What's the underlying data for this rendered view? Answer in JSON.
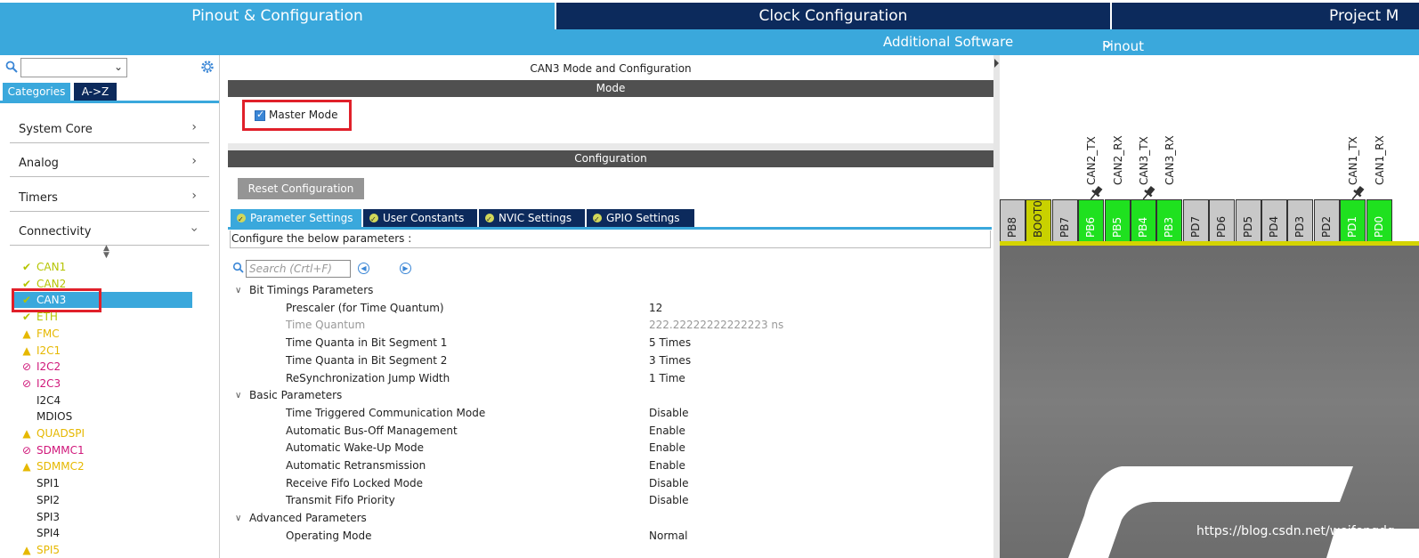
{
  "top_tabs": [
    {
      "label": "Pinout & Configuration"
    },
    {
      "label": "Clock Configuration"
    },
    {
      "label": "Project M"
    }
  ],
  "subbar": {
    "additional_software": "Additional Software",
    "pinout": "Pinout"
  },
  "left": {
    "tabs": [
      "Categories",
      "A->Z"
    ],
    "categories": [
      "System Core",
      "Analog",
      "Timers",
      "Connectivity"
    ],
    "items": [
      {
        "label": "CAN1",
        "status": "ok"
      },
      {
        "label": "CAN2",
        "status": "ok"
      },
      {
        "label": "CAN3",
        "status": "ok"
      },
      {
        "label": "ETH",
        "status": "ok"
      },
      {
        "label": "FMC",
        "status": "warning"
      },
      {
        "label": "I2C1",
        "status": "warning"
      },
      {
        "label": "I2C2",
        "status": "disabled"
      },
      {
        "label": "I2C3",
        "status": "disabled"
      },
      {
        "label": "I2C4",
        "status": "none"
      },
      {
        "label": "MDIOS",
        "status": "none"
      },
      {
        "label": "QUADSPI",
        "status": "warning"
      },
      {
        "label": "SDMMC1",
        "status": "disabled"
      },
      {
        "label": "SDMMC2",
        "status": "warning"
      },
      {
        "label": "SPI1",
        "status": "none"
      },
      {
        "label": "SPI2",
        "status": "none"
      },
      {
        "label": "SPI3",
        "status": "none"
      },
      {
        "label": "SPI4",
        "status": "none"
      },
      {
        "label": "SPI5",
        "status": "warning"
      }
    ],
    "selected_item": "CAN3"
  },
  "middle": {
    "title": "CAN3 Mode and Configuration",
    "mode_header": "Mode",
    "master_mode_label": "Master Mode",
    "master_mode_checked": true,
    "config_header": "Configuration",
    "reset_button": "Reset Configuration",
    "param_tabs": [
      "Parameter Settings",
      "User Constants",
      "NVIC Settings",
      "GPIO Settings"
    ],
    "configure_text": "Configure the below parameters :",
    "search_placeholder": "Search (Crtl+F)",
    "groups": [
      {
        "name": "Bit Timings Parameters",
        "params": [
          {
            "name": "Prescaler (for Time Quantum)",
            "value": "12",
            "muted": false
          },
          {
            "name": "Time Quantum",
            "value": "222.22222222222223 ns",
            "muted": true
          },
          {
            "name": "Time Quanta in Bit Segment 1",
            "value": "5 Times",
            "muted": false
          },
          {
            "name": "Time Quanta in Bit Segment 2",
            "value": "3 Times",
            "muted": false
          },
          {
            "name": "ReSynchronization Jump Width",
            "value": "1 Time",
            "muted": false
          }
        ]
      },
      {
        "name": "Basic Parameters",
        "params": [
          {
            "name": "Time Triggered Communication Mode",
            "value": "Disable",
            "muted": false
          },
          {
            "name": "Automatic Bus-Off Management",
            "value": "Enable",
            "muted": false
          },
          {
            "name": "Automatic Wake-Up Mode",
            "value": "Enable",
            "muted": false
          },
          {
            "name": "Automatic Retransmission",
            "value": "Enable",
            "muted": false
          },
          {
            "name": "Receive Fifo Locked Mode",
            "value": "Disable",
            "muted": false
          },
          {
            "name": "Transmit Fifo Priority",
            "value": "Disable",
            "muted": false
          }
        ]
      },
      {
        "name": "Advanced Parameters",
        "params": [
          {
            "name": "Operating Mode",
            "value": "Normal",
            "muted": false
          }
        ]
      }
    ]
  },
  "right": {
    "pins": [
      {
        "label": "PB8",
        "color": "gray"
      },
      {
        "label": "BOOT0",
        "color": "yellow"
      },
      {
        "label": "PB7",
        "color": "gray"
      },
      {
        "label": "PB6",
        "color": "green"
      },
      {
        "label": "PB5",
        "color": "green"
      },
      {
        "label": "PB4",
        "color": "green"
      },
      {
        "label": "PB3",
        "color": "green"
      },
      {
        "label": "PD7",
        "color": "gray"
      },
      {
        "label": "PD6",
        "color": "gray"
      },
      {
        "label": "PD5",
        "color": "gray"
      },
      {
        "label": "PD4",
        "color": "gray"
      },
      {
        "label": "PD3",
        "color": "gray"
      },
      {
        "label": "PD2",
        "color": "gray"
      },
      {
        "label": "PD1",
        "color": "green"
      },
      {
        "label": "PD0",
        "color": "green"
      }
    ],
    "signals": [
      {
        "pin": "PB6",
        "label": "CAN2_TX"
      },
      {
        "pin": "PB5",
        "label": "CAN2_RX"
      },
      {
        "pin": "PB4",
        "label": "CAN3_TX"
      },
      {
        "pin": "PB3",
        "label": "CAN3_RX"
      },
      {
        "pin": "PD1",
        "label": "CAN1_TX"
      },
      {
        "pin": "PD0",
        "label": "CAN1_RX"
      }
    ],
    "watermark": "https://blog.csdn.net/weifengdq"
  },
  "colors": {
    "accent": "#3aa8dc",
    "dark_tab": "#0c2a5c",
    "header_bar": "#505050",
    "pin_green": "#1fe11f",
    "pin_yellow": "#c9d100",
    "highlight_box": "#e0202a",
    "status_ok": "#b5c400",
    "status_warning": "#e6b800",
    "status_disabled": "#d0177a"
  }
}
